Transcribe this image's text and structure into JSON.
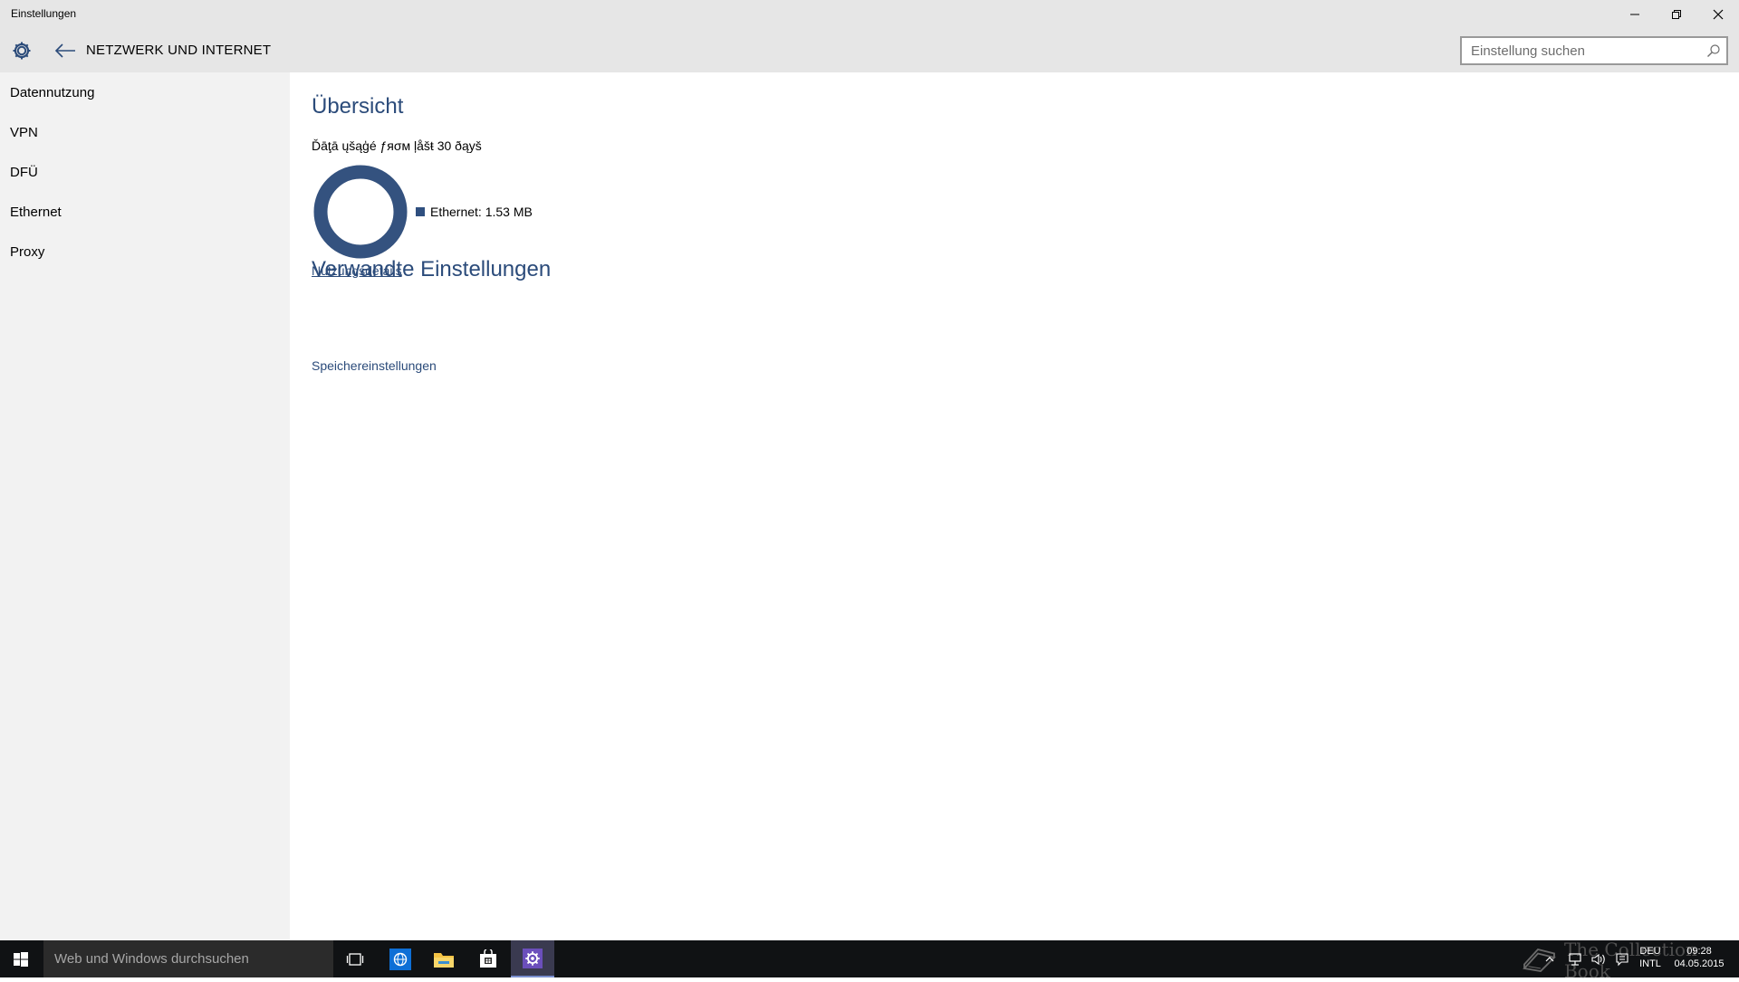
{
  "window": {
    "title": "Einstellungen"
  },
  "header": {
    "page_title": "NETZWERK UND INTERNET",
    "search_placeholder": "Einstellung suchen"
  },
  "sidebar": {
    "items": [
      {
        "label": "Datennutzung"
      },
      {
        "label": "VPN"
      },
      {
        "label": "DFÜ"
      },
      {
        "label": "Ethernet"
      },
      {
        "label": "Proxy"
      }
    ]
  },
  "main": {
    "overview_title": "Übersicht",
    "usage_subtitle": "Ďāţā ųšąģé ƒяσм ļåšŧ 30 ðąyš",
    "legend_label": "Ethernet: 1.53 MB",
    "details_link": "Nutzungsdetails",
    "related_title": "Verwandte Einstellungen",
    "storage_link": "Speichereinstellungen",
    "donut_share": 1.0
  },
  "taskbar": {
    "search_placeholder": "Web und Windows durchsuchen",
    "language_top": "DEU",
    "language_bottom": "INTL",
    "time": "09:28",
    "date": "04.05.2015",
    "watermark": "The Collection Book"
  },
  "colors": {
    "accent": "#2b4b7a",
    "donut": "#34527f",
    "chrome": "#e6e6e6",
    "sidebar_bg": "#f2f2f2",
    "taskbar_bg": "#101214"
  },
  "icons": {
    "settings": "gear-icon",
    "back": "back-arrow-icon",
    "search": "search-icon",
    "minimize": "minimize-icon",
    "maximize": "restore-icon",
    "close": "close-icon",
    "start": "windows-logo-icon",
    "task_view": "task-view-icon",
    "browser": "browser-icon",
    "explorer": "folder-icon",
    "store": "store-icon",
    "settings_app": "settings-app-icon",
    "tray_network": "network-icon",
    "tray_volume": "volume-icon",
    "tray_notifications": "notification-icon",
    "tray_chevron": "chevron-up-icon"
  }
}
